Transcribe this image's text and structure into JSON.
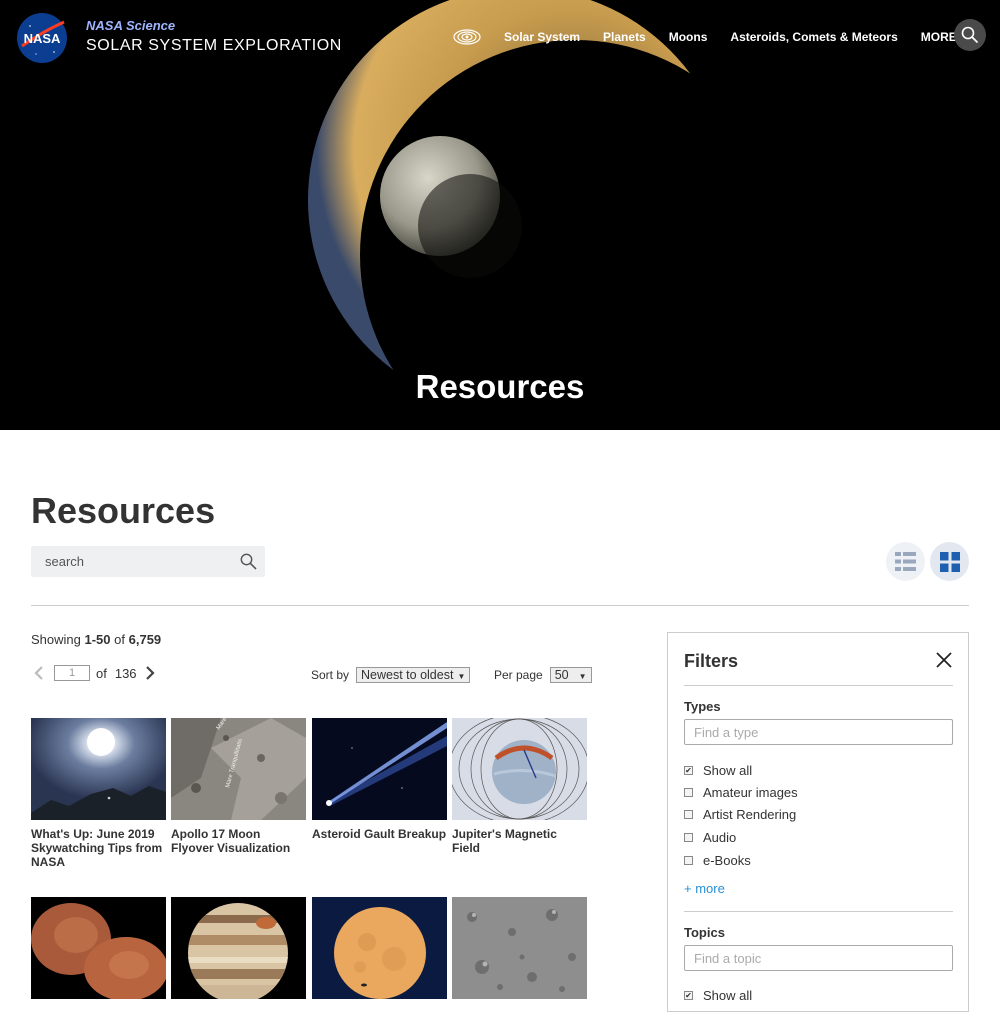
{
  "header": {
    "brand_sub": "NASA Science",
    "brand_main": "SOLAR SYSTEM EXPLORATION",
    "nav": [
      "Solar System",
      "Planets",
      "Moons",
      "Asteroids, Comets & Meteors",
      "MORE"
    ],
    "hero_title": "Resources"
  },
  "main": {
    "heading": "Resources",
    "search_placeholder": "search",
    "showing_prefix": "Showing",
    "showing_range": "1-50",
    "showing_of": "of",
    "showing_total": "6,759",
    "page_current": "1",
    "page_of": "of",
    "page_total": "136",
    "sort_label": "Sort by",
    "sort_value": "Newest to oldest",
    "per_page_label": "Per page",
    "per_page_value": "50",
    "cards": [
      {
        "title": "What's Up: June 2019 Skywatching Tips from NASA"
      },
      {
        "title": "Apollo 17 Moon Flyover Visualization"
      },
      {
        "title": "Asteroid Gault Breakup"
      },
      {
        "title": "Jupiter's Magnetic Field"
      },
      {
        "title": ""
      },
      {
        "title": ""
      },
      {
        "title": ""
      },
      {
        "title": ""
      }
    ],
    "apollo_labels": [
      "Mare Serenitatis",
      "Mare Tranquillitatis"
    ]
  },
  "filters": {
    "title": "Filters",
    "types_heading": "Types",
    "types_placeholder": "Find a type",
    "types": [
      {
        "label": "Show all",
        "checked": true
      },
      {
        "label": "Amateur images",
        "checked": false
      },
      {
        "label": "Artist Rendering",
        "checked": false
      },
      {
        "label": "Audio",
        "checked": false
      },
      {
        "label": "e-Books",
        "checked": false
      }
    ],
    "more_label": "+ more",
    "topics_heading": "Topics",
    "topics_placeholder": "Find a topic",
    "topics_show_all": "Show all"
  },
  "colors": {
    "link": "#2a8fd6",
    "grid_icon": "#1f5fb0",
    "list_icon": "#9aa8bd"
  }
}
